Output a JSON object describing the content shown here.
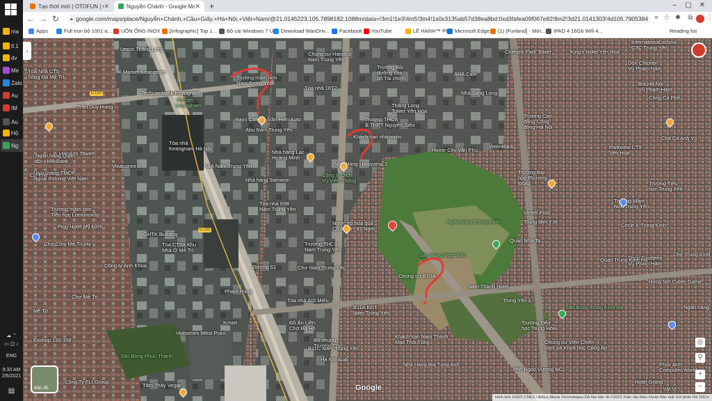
{
  "taskbar": {
    "items": [
      {
        "label": "ma",
        "color": "#f4b400"
      },
      {
        "label": "tl.1",
        "color": "#f4b400"
      },
      {
        "label": "dv",
        "color": "#f4b400"
      },
      {
        "label": "Me",
        "color": "#a64bd3"
      },
      {
        "label": "Zalo",
        "color": "#1e88e5"
      },
      {
        "label": "Au",
        "color": "#d23b2f"
      },
      {
        "label": "IM",
        "color": "#d23b2f"
      },
      {
        "label": "Au",
        "color": "#555555"
      },
      {
        "label": "Hộ",
        "color": "#f4b400"
      },
      {
        "label": "Ng",
        "color": "#34a853"
      }
    ],
    "tray_lang": "ENG",
    "time": "9:33 AM",
    "date": "2/6/2021"
  },
  "browser": {
    "tabs": [
      {
        "title": "Tạo thớt mới | OTOFUN | CỘNG...",
        "color": "#e8710a"
      },
      {
        "title": "Nguyễn Chánh - Google Maps",
        "color": "#34a853"
      }
    ],
    "new_tab": "+",
    "url": "google.com/maps/place/Nguyễn+Chánh,+Cầu+Giấy,+Hà+Nội,+Việt+Nam/@21.0145223,105.7898182,1088m/data=!3m1!1e3!4m5!3m4!1s0x3135ab57d38ea8bd:0xd3fafea09f067e82!8m2!3d21.0141303!4d105.7905384",
    "bookmarks": [
      {
        "label": "Apps",
        "color": "#4285f4"
      },
      {
        "label": "Full trọn bộ 1001 ic...",
        "color": "#1e88e5"
      },
      {
        "label": "UỐN ỐNG INOX 30...",
        "color": "#d23b2f"
      },
      {
        "label": "[Infographic] Top 1...",
        "color": "#e8710a"
      },
      {
        "label": "Bộ cài Windows 7 U...",
        "color": "#555555"
      },
      {
        "label": "Download WanDriv...",
        "color": "#1e88e5"
      },
      {
        "label": "Facebook",
        "color": "#1877f2"
      },
      {
        "label": "YouTube",
        "color": "#ff0000"
      },
      {
        "label": "LÊ HẠNH™ PC",
        "color": "#f4b400"
      },
      {
        "label": "Microsoft Edge",
        "color": "#0078d4"
      },
      {
        "label": "(1) [Funland] - Mời...",
        "color": "#e8710a"
      },
      {
        "label": "IPAD 4 16Gb Wifi 4...",
        "color": "#555555"
      }
    ],
    "reading_list": "Reading list"
  },
  "map": {
    "labels": [
      {
        "text": "Lexus Thăng Long",
        "cls": ""
      },
      {
        "text": "Chung cư Handico\nNam Trung Yên",
        "cls": ""
      },
      {
        "text": "Chelsea Park Tower",
        "cls": ""
      },
      {
        "text": "King's Hotel Yên Hòa",
        "cls": ""
      },
      {
        "text": "International school\nG3C Trung Yên",
        "cls": ""
      },
      {
        "text": "Tòa Nhà CT5\nSông Đà Mễ Trì",
        "cls": ""
      },
      {
        "text": "K Market Keangnam",
        "cls": ""
      },
      {
        "text": "Trường mầm non\nNam Trung Yên",
        "cls": ""
      },
      {
        "text": "Trường Bồi\ndưỡng cán\nbộ Tài chính",
        "cls": ""
      },
      {
        "text": "AHA Cafe",
        "cls": ""
      },
      {
        "text": "Don Chicken\nVũ Phạm Hàm",
        "cls": ""
      },
      {
        "text": "Techcombank Keangnam",
        "cls": ""
      },
      {
        "text": "Tòa nhà 18T2",
        "cls": ""
      },
      {
        "text": "Trần Duy Hưng",
        "cls": ""
      },
      {
        "text": "Bia Hà Nội\nVũ Phạm Hàm",
        "cls": ""
      },
      {
        "text": "Vincom\nKeangnam",
        "cls": "green"
      },
      {
        "text": "Rayo Cafe",
        "cls": ""
      },
      {
        "text": "Vân Hiền Auto",
        "cls": ""
      },
      {
        "text": "Thăng Long\nTower Yên Hòa",
        "cls": ""
      },
      {
        "text": "Công Cà Phê",
        "cls": ""
      },
      {
        "text": "Nhà Sang Long",
        "cls": ""
      },
      {
        "text": "Abu Nam Trung Yên",
        "cls": ""
      },
      {
        "text": "Trường THCS\n& THPT Nguyễn Siêu",
        "cls": ""
      },
      {
        "text": "Trường Cao\nđẳng Cộng\nđồng Hà Nội",
        "cls": ""
      },
      {
        "text": "Handico Tower",
        "cls": ""
      },
      {
        "text": "Tòa nhà\nKeangnam Hà Nội",
        "cls": ""
      },
      {
        "text": "Khách sạn nhà nước",
        "cls": ""
      },
      {
        "text": "Home City Văn Phú",
        "cls": ""
      },
      {
        "text": "VietinBank",
        "cls": ""
      },
      {
        "text": "Parkview CT9\nYên Hòa",
        "cls": ""
      },
      {
        "text": "Chả Cá Anh Vũ",
        "cls": ""
      },
      {
        "text": "Ngân hàng Quân\nđội - MB Bank",
        "cls": ""
      },
      {
        "text": "Nhà hàng Lạc\nHoàng Minh",
        "cls": ""
      },
      {
        "text": "Nhà Hàng Hatoyama 2",
        "cls": ""
      },
      {
        "text": "Trường Đại\nhọc Phương\nĐông",
        "cls": ""
      },
      {
        "text": "Vinaconex 9",
        "cls": ""
      },
      {
        "text": "A&A Nam Trung Yên",
        "cls": ""
      },
      {
        "text": "Công ty Dịch\nVụ Viễn Thông",
        "cls": "green"
      },
      {
        "text": "Ngân hàng TMCP\nNgoại thương Việt Nam",
        "cls": ""
      },
      {
        "text": "Cư Thế",
        "cls": ""
      },
      {
        "text": "Nhà hàng Samwon",
        "cls": ""
      },
      {
        "text": "Trường Tiểu\nhọc Trung Yên",
        "cls": ""
      },
      {
        "text": "Viettel Post",
        "cls": ""
      },
      {
        "text": "Trung tâm Y tế",
        "cls": ""
      },
      {
        "text": "Tòa nhà 93B\nNam Trung Yên",
        "cls": ""
      },
      {
        "text": "Nước ép hoa quả\nCô Minh - #1 Nam",
        "cls": ""
      },
      {
        "text": "Trường mầm non\nTiểu học Lomonoxốp",
        "cls": ""
      },
      {
        "text": "Ngân hàng Trung Kính",
        "cls": "green"
      },
      {
        "text": "Trường Mầm\nNon Trung Yên",
        "cls": ""
      },
      {
        "text": "Circle K Trung Kính",
        "cls": ""
      },
      {
        "text": "Ping Hotel Mỹ Đình",
        "cls": ""
      },
      {
        "text": "GHTK Building",
        "cls": ""
      },
      {
        "text": "Tòa CT5A Khu\nNhà Ở Mễ Trì",
        "cls": ""
      },
      {
        "text": "Quán Nhà Ta",
        "cls": ""
      },
      {
        "text": "Chợ Cốm Mễ Trì Hạ",
        "cls": ""
      },
      {
        "text": "Trường THCS\nNam Trung Yên",
        "cls": ""
      },
      {
        "text": "Sân Bóng Ngọc Bảo",
        "cls": "green"
      },
      {
        "text": "Shop Fourteen\nVũ Phạm Hàm",
        "cls": ""
      },
      {
        "text": "Chợ Trung Kính",
        "cls": ""
      },
      {
        "text": "Công ty Ánh Khoa",
        "cls": ""
      },
      {
        "text": "Chợ Nam Trung Yên",
        "cls": ""
      },
      {
        "text": "Nam Thành Hotel",
        "cls": ""
      },
      {
        "text": "Quán Trung Kinh Hà",
        "cls": ""
      },
      {
        "text": "Hung Net Cyber Game",
        "cls": ""
      },
      {
        "text": "Chung cư B10A",
        "cls": ""
      },
      {
        "text": "Trung Yên 1",
        "cls": ""
      },
      {
        "text": "Chợ Mễ Trì",
        "cls": ""
      },
      {
        "text": "Tòa nhà AIS Miếu",
        "cls": ""
      },
      {
        "text": "B11A KĐT\nNam Trung Yên",
        "cls": ""
      },
      {
        "text": "Sân Bóng Trung Kính Hà",
        "cls": "green"
      },
      {
        "text": "Ngân hàng",
        "cls": ""
      },
      {
        "text": "Mễ Trì",
        "cls": ""
      },
      {
        "text": "Kmart",
        "cls": ""
      },
      {
        "text": "Trường Tiểu\nhọc Trung Hòa",
        "cls": ""
      },
      {
        "text": "Exshop 135-158",
        "cls": ""
      },
      {
        "text": "Vinhomes West Point",
        "cls": ""
      },
      {
        "text": "Đồ Ăn Liền\nChợ Bà Hồ",
        "cls": ""
      },
      {
        "text": "Khách sạn Nam Thành\nMạc Thái Tông",
        "cls": ""
      },
      {
        "text": "Bò nhúng\nTrường Chợ",
        "cls": ""
      },
      {
        "text": "Chung cư Viện Chiến\nlược và Khoa học Công An",
        "cls": ""
      },
      {
        "text": "Hà Nội Audi",
        "cls": ""
      },
      {
        "text": "B11C Nam Trung Yên",
        "cls": ""
      },
      {
        "text": "Sân Bóng Phúc Thành",
        "cls": "green"
      },
      {
        "text": "Nhà Hàng Bia Tùng Anh",
        "cls": ""
      },
      {
        "text": "Phúc Anh\nComputer World",
        "cls": ""
      },
      {
        "text": "Công Ty FLI Group",
        "cls": ""
      },
      {
        "text": "Tâm Thảy Vegar",
        "cls": ""
      },
      {
        "text": "Phố Ngọc Vương NC",
        "cls": ""
      },
      {
        "text": "Hotel Grand",
        "cls": ""
      },
      {
        "text": "Vật Vị",
        "cls": ""
      },
      {
        "text": "Phạm Hùng",
        "cls": ""
      },
      {
        "text": "Đường 61",
        "cls": ""
      }
    ],
    "road_tags": [
      "CT20",
      "CT20",
      "CT20"
    ],
    "layers_label": "Bản đồ",
    "google": "Google",
    "attribution": "Hình ảnh ©2021 CNES / Airbus,Maxar Technologies,Dữ liệu bản đồ ©2021   Toàn cầu   Điều khoản   Bảo mật   Gửi phản hồi   100 m",
    "collapse": "‹"
  }
}
